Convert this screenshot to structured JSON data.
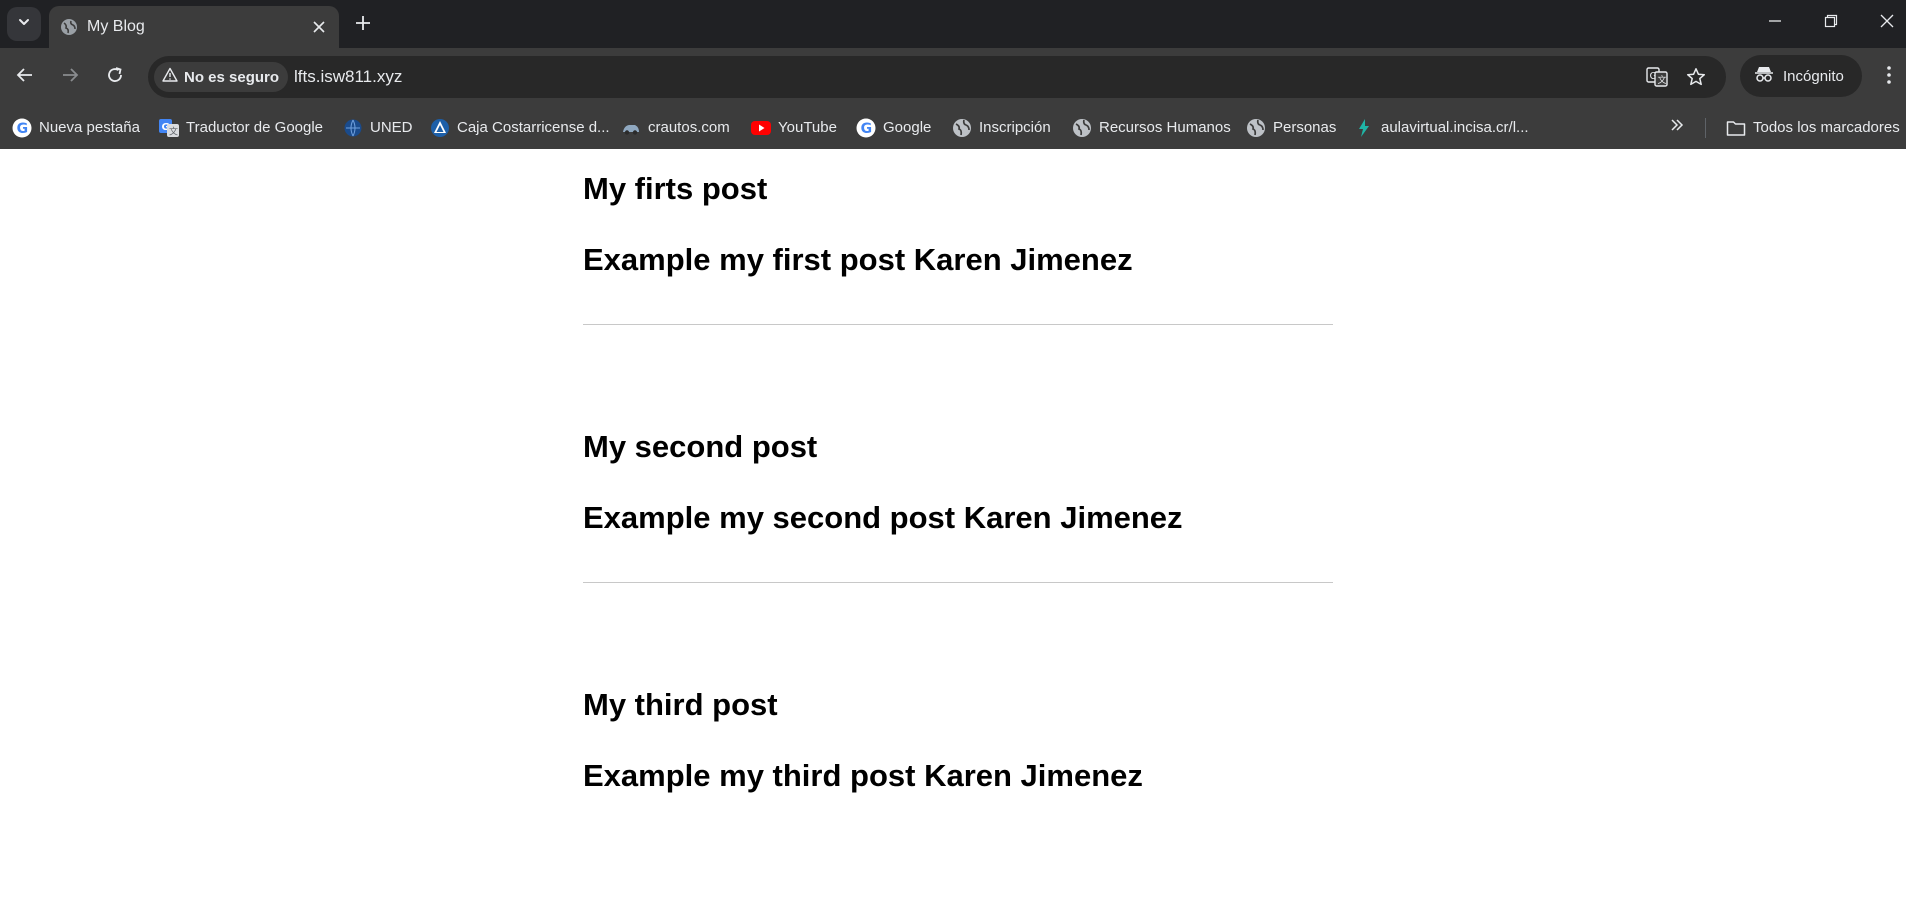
{
  "browser": {
    "tab_title": "My Blog",
    "security_label": "No es seguro",
    "url": "lfts.isw811.xyz",
    "incognito_label": "Incógnito",
    "bookmarks": [
      {
        "label": "Nueva pestaña",
        "icon": "google-icon"
      },
      {
        "label": "Traductor de Google",
        "icon": "translate-icon"
      },
      {
        "label": "UNED",
        "icon": "uned-icon"
      },
      {
        "label": "Caja Costarricense d...",
        "icon": "ccss-icon"
      },
      {
        "label": "crautos.com",
        "icon": "crautos-icon"
      },
      {
        "label": "YouTube",
        "icon": "youtube-icon"
      },
      {
        "label": "Google",
        "icon": "google-icon"
      },
      {
        "label": "Inscripción",
        "icon": "globe-icon"
      },
      {
        "label": "Recursos Humanos",
        "icon": "globe-icon"
      },
      {
        "label": "Personas",
        "icon": "globe-icon"
      },
      {
        "label": "aulavirtual.incisa.cr/l...",
        "icon": "aulavirtual-icon"
      }
    ],
    "all_bookmarks_label": "Todos los marcadores"
  },
  "posts": [
    {
      "title": "My firts post",
      "body": "Example my first post Karen Jimenez"
    },
    {
      "title": "My second post",
      "body": "Example my second post Karen Jimenez"
    },
    {
      "title": "My third post",
      "body": "Example my third post Karen Jimenez"
    }
  ],
  "colors": {
    "tabbar_bg": "#202124",
    "toolbar_bg": "#3c3c3c",
    "omnibox_bg": "#282828",
    "chrome_text": "#e8eaed",
    "page_bg": "#ffffff",
    "post_text": "#000000",
    "divider": "#c8c8c8"
  }
}
